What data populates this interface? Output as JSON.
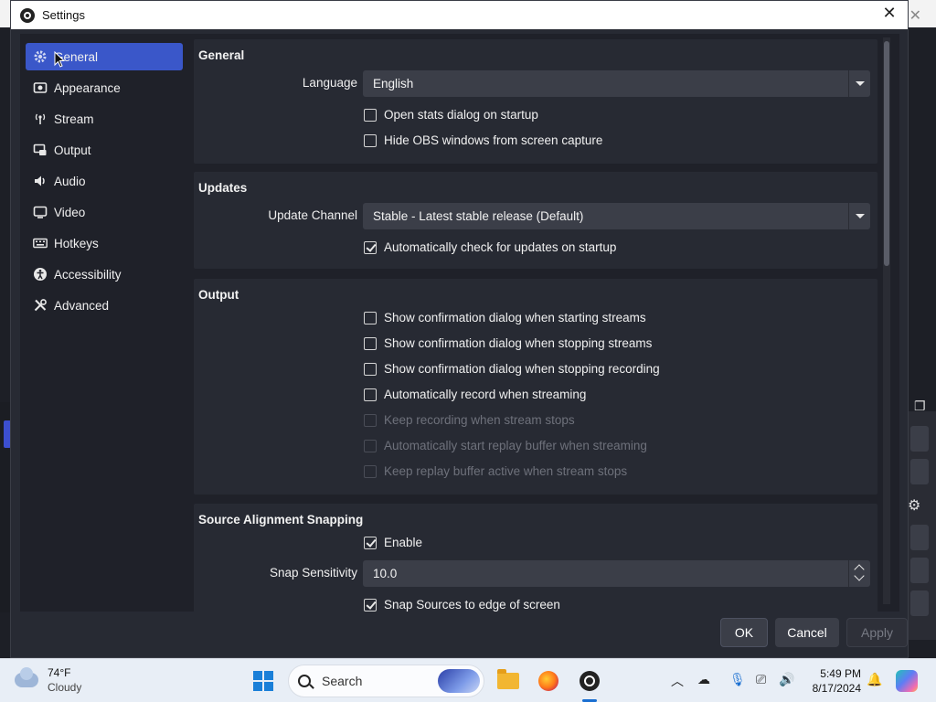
{
  "window": {
    "title": "Settings"
  },
  "sidebar": {
    "items": [
      {
        "label": "General",
        "icon": "gear-icon",
        "active": true
      },
      {
        "label": "Appearance",
        "icon": "appearance-icon"
      },
      {
        "label": "Stream",
        "icon": "antenna-icon"
      },
      {
        "label": "Output",
        "icon": "output-icon"
      },
      {
        "label": "Audio",
        "icon": "speaker-icon"
      },
      {
        "label": "Video",
        "icon": "monitor-icon"
      },
      {
        "label": "Hotkeys",
        "icon": "keyboard-icon"
      },
      {
        "label": "Accessibility",
        "icon": "accessibility-icon"
      },
      {
        "label": "Advanced",
        "icon": "tools-icon"
      }
    ]
  },
  "general": {
    "title": "General",
    "language_label": "Language",
    "language_value": "English",
    "open_stats": {
      "label": "Open stats dialog on startup",
      "checked": false
    },
    "hide_obs": {
      "label": "Hide OBS windows from screen capture",
      "checked": false
    }
  },
  "updates": {
    "title": "Updates",
    "channel_label": "Update Channel",
    "channel_value": "Stable - Latest stable release (Default)",
    "auto_check": {
      "label": "Automatically check for updates on startup",
      "checked": true
    }
  },
  "output": {
    "title": "Output",
    "options": [
      {
        "label": "Show confirmation dialog when starting streams",
        "checked": false,
        "disabled": false
      },
      {
        "label": "Show confirmation dialog when stopping streams",
        "checked": false,
        "disabled": false
      },
      {
        "label": "Show confirmation dialog when stopping recording",
        "checked": false,
        "disabled": false
      },
      {
        "label": "Automatically record when streaming",
        "checked": false,
        "disabled": false
      },
      {
        "label": "Keep recording when stream stops",
        "checked": false,
        "disabled": true
      },
      {
        "label": "Automatically start replay buffer when streaming",
        "checked": false,
        "disabled": true
      },
      {
        "label": "Keep replay buffer active when stream stops",
        "checked": false,
        "disabled": true
      }
    ]
  },
  "snapping": {
    "title": "Source Alignment Snapping",
    "enable": {
      "label": "Enable",
      "checked": true
    },
    "sensitivity_label": "Snap Sensitivity",
    "sensitivity_value": "10.0",
    "snap_edge": {
      "label": "Snap Sources to edge of screen",
      "checked": true
    }
  },
  "buttons": {
    "ok": "OK",
    "cancel": "Cancel",
    "apply": "Apply"
  },
  "taskbar": {
    "weather_temp": "74°F",
    "weather_cond": "Cloudy",
    "search_placeholder": "Search",
    "time": "5:49 PM",
    "date": "8/17/2024"
  },
  "colors": {
    "accent": "#3a57c9",
    "dialog_bg": "#272a33",
    "panel_bg": "#1f2129"
  }
}
